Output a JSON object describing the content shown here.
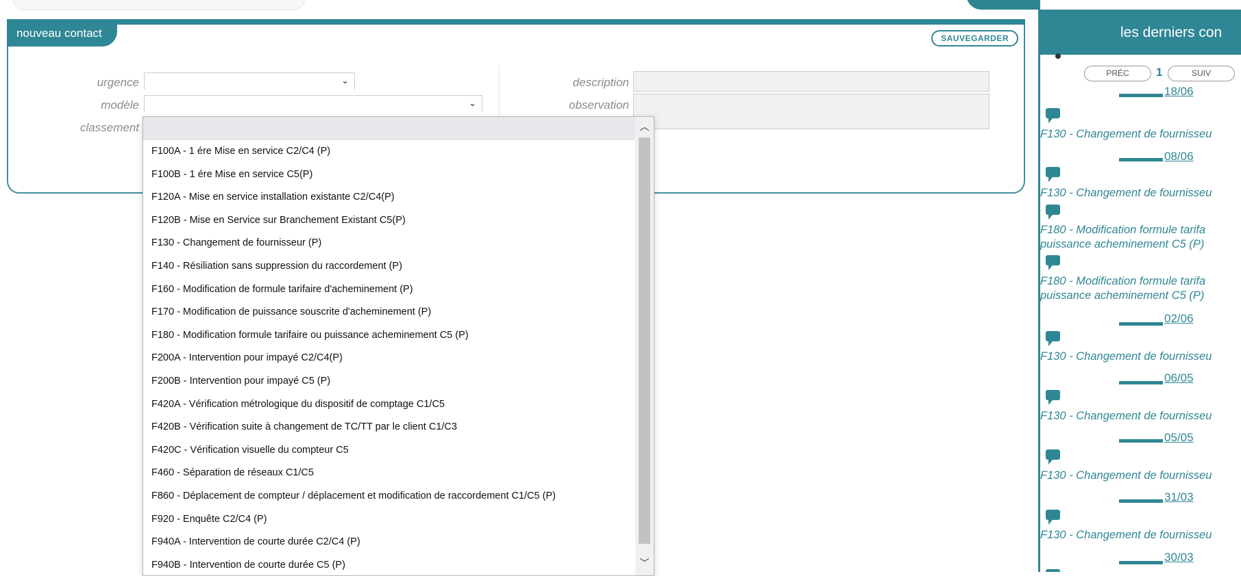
{
  "form": {
    "tab_label": "nouveau contact",
    "save_label": "SAUVEGARDER",
    "labels": {
      "urgence": "urgence",
      "modele": "modèle",
      "classement": "classement",
      "description": "description",
      "observation": "observation"
    },
    "values": {
      "urgence": "",
      "modele": "",
      "classement": "",
      "description": "",
      "observation": ""
    }
  },
  "dropdown": {
    "open_for": "classement",
    "selected_index": 0,
    "options": [
      "F100A - 1 ére Mise en service C2/C4 (P)",
      "F100B - 1 ére Mise en service C5(P)",
      "F120A - Mise en service installation existante C2/C4(P)",
      "F120B - Mise en Service sur Branchement Existant C5(P)",
      "F130 - Changement de fournisseur (P)",
      "F140 - Résiliation sans suppression du raccordement (P)",
      "F160 - Modification de formule tarifaire d'acheminement (P)",
      "F170 - Modification de puissance souscrite d'acheminement (P)",
      "F180 - Modification formule tarifaire ou puissance acheminement C5 (P)",
      "F200A - Intervention pour impayé C2/C4(P)",
      "F200B - Intervention pour impayé C5 (P)",
      "F420A - Vérification métrologique du dispositif de comptage C1/C5",
      "F420B - Vérification suite à changement de TC/TT par le client C1/C3",
      "F420C - Vérification visuelle du compteur C5",
      "F460 - Séparation de réseaux C1/C5",
      "F860 - Déplacement de compteur / déplacement et modification de raccordement C1/C5 (P)",
      "F920 - Enquête C2/C4 (P)",
      "F940A - Intervention de courte durée C2/C4 (P)",
      "F940B - Intervention de courte durée C5 (P)"
    ],
    "icons": {
      "scroll_up": "chevron-up-icon",
      "scroll_down": "chevron-down-icon"
    }
  },
  "sidebar": {
    "title": "les derniers con",
    "pagination": {
      "prev_label": "PRÉC",
      "page": "1",
      "next_label": "SUIV"
    },
    "entries": [
      {
        "date": "18/06",
        "text": [
          "F130 - Changement de fournisseu"
        ]
      },
      {
        "date": "08/06",
        "text": [
          "F130 - Changement de fournisseu"
        ]
      },
      {
        "date": "",
        "text": [
          "F180 - Modification formule tarifa",
          "puissance acheminement C5 (P)"
        ]
      },
      {
        "date": "",
        "text": [
          "F180 - Modification formule tarifa",
          "puissance acheminement C5 (P)"
        ]
      },
      {
        "date": "02/06",
        "text": [
          "F130 - Changement de fournisseu"
        ]
      },
      {
        "date": "06/05",
        "text": [
          "F130 - Changement de fournisseu"
        ]
      },
      {
        "date": "05/05",
        "text": [
          "F130 - Changement de fournisseu"
        ]
      },
      {
        "date": "31/03",
        "text": [
          "F130 - Changement de fournisseu"
        ]
      },
      {
        "date": "30/03",
        "text": []
      }
    ]
  },
  "colors": {
    "accent": "#2f8694",
    "label_gray": "#8a8a8a"
  }
}
